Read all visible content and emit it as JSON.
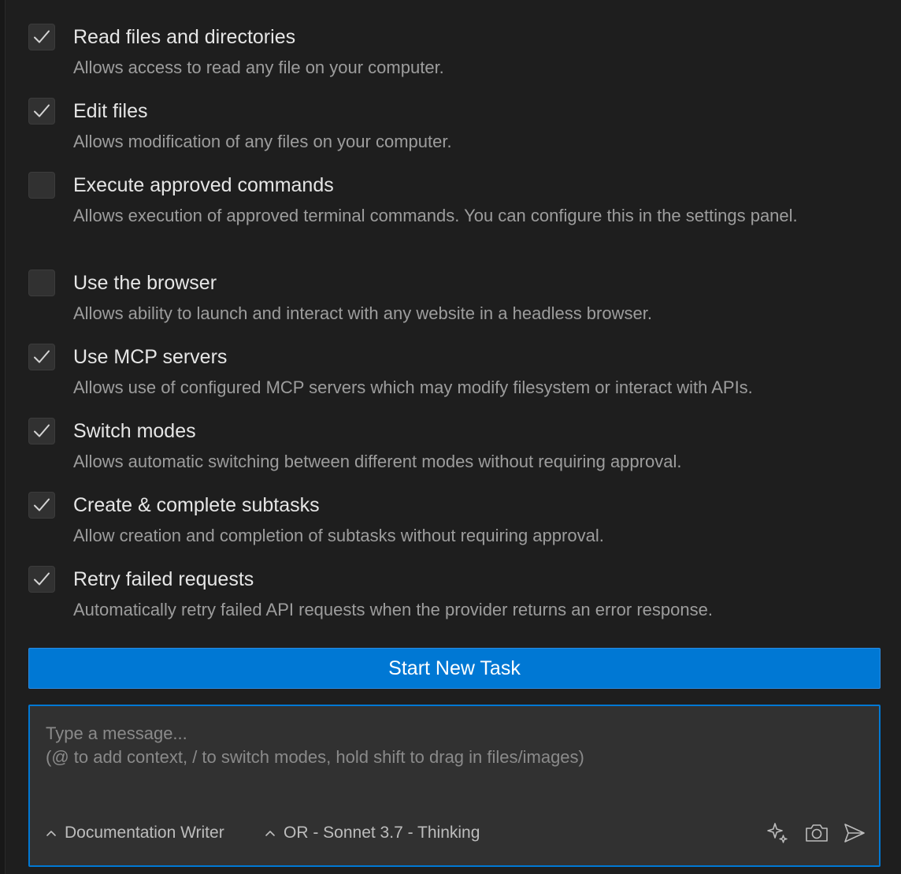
{
  "permissions": [
    {
      "label": "Read files and directories",
      "description": "Allows access to read any file on your computer.",
      "checked": true
    },
    {
      "label": "Edit files",
      "description": "Allows modification of any files on your computer.",
      "checked": true
    },
    {
      "label": "Execute approved commands",
      "description": "Allows execution of approved terminal commands. You can configure this in the settings panel.",
      "checked": false
    },
    {
      "label": "Use the browser",
      "description": "Allows ability to launch and interact with any website in a headless browser.",
      "checked": false
    },
    {
      "label": "Use MCP servers",
      "description": "Allows use of configured MCP servers which may modify filesystem or interact with APIs.",
      "checked": true
    },
    {
      "label": "Switch modes",
      "description": "Allows automatic switching between different modes without requiring approval.",
      "checked": true
    },
    {
      "label": "Create & complete subtasks",
      "description": "Allow creation and completion of subtasks without requiring approval.",
      "checked": true
    },
    {
      "label": "Retry failed requests",
      "description": "Automatically retry failed API requests when the provider returns an error response.",
      "checked": true
    }
  ],
  "start_button_label": "Start New Task",
  "chat": {
    "placeholder": "Type a message...\n(@ to add context, / to switch modes, hold shift to drag in files/images)",
    "value": "",
    "mode_selector": "Documentation Writer",
    "model_selector": "OR - Sonnet 3.7 - Thinking",
    "icons": [
      "enhance-prompt-icon",
      "camera-icon",
      "send-icon"
    ]
  },
  "colors": {
    "accent": "#0078d4",
    "background": "#1e1e1e",
    "checkbox_bg": "#313131",
    "text": "#e6e6e6",
    "muted_text": "#9d9d9d"
  }
}
